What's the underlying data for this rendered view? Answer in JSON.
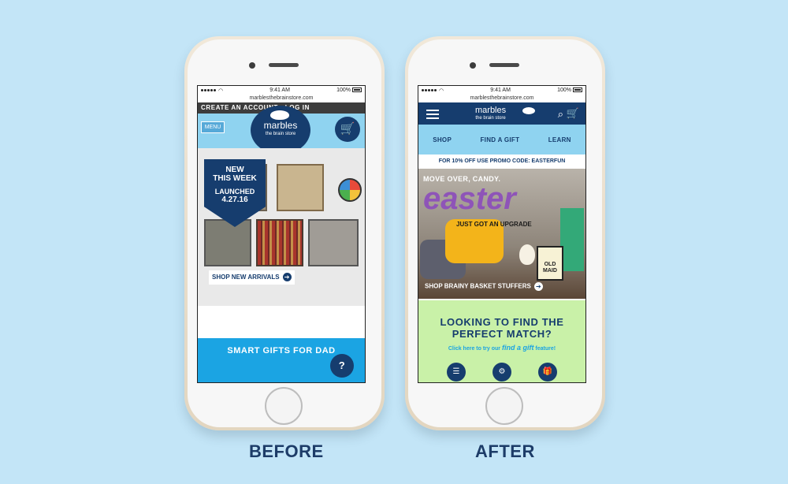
{
  "before": {
    "status": {
      "time": "9:41 AM",
      "battery": "100%"
    },
    "url": "marblesthebrainstore.com",
    "account_bar": "CREATE AN ACCOUNT - LOG IN",
    "menu_label": "MENU",
    "logo": {
      "name": "marbles",
      "sub": "the brain store"
    },
    "new_badge": {
      "line1": "NEW",
      "line2": "THIS WEEK",
      "line3": "LAUNCHED",
      "line4": "4.27.16"
    },
    "shop_cta": "SHOP NEW ARRIVALS",
    "banner": "SMART GIFTS FOR DAD",
    "help_label": "?",
    "caption": "BEFORE"
  },
  "after": {
    "status": {
      "time": "9:41 AM",
      "battery": "100%"
    },
    "url": "marblesthebrainstore.com",
    "logo": {
      "name": "marbles",
      "sub": "the brain store"
    },
    "nav": [
      "SHOP",
      "FIND A GIFT",
      "LEARN"
    ],
    "promo": "FOR 10% OFF USE PROMO CODE: EASTERFUN",
    "hero": {
      "line1": "MOVE OVER, CANDY.",
      "headline": "easter",
      "line2": "JUST GOT AN UPGRADE",
      "product": "OLD MAID"
    },
    "shop_cta": "SHOP BRAINY BASKET STUFFERS",
    "match": {
      "title": "LOOKING TO FIND THE PERFECT MATCH?",
      "text_pre": "Click here to try our",
      "text_em": "find a gift",
      "text_post": "feature!"
    },
    "caption": "AFTER"
  },
  "colors": {
    "navy": "#163d6e",
    "light_blue": "#8fd3f0",
    "bright_blue": "#1ba4e3",
    "green": "#c9f1a8",
    "background": "#c3e5f7"
  }
}
